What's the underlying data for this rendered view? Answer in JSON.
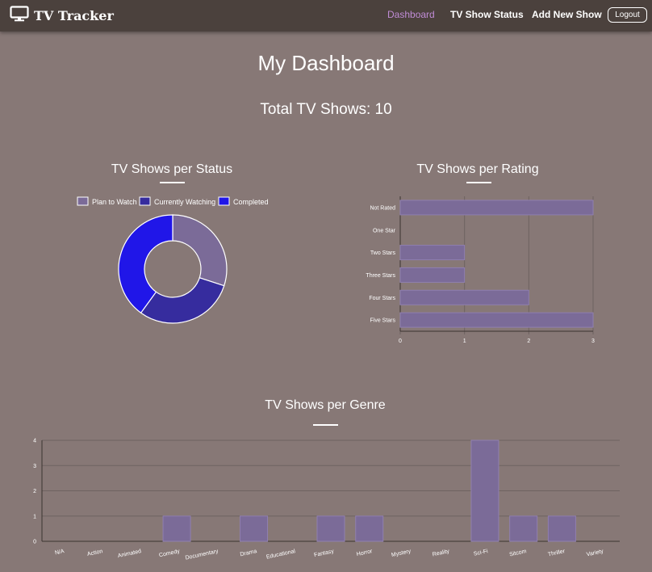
{
  "navbar": {
    "brand": "TV Tracker",
    "brand_icon": "tv-monitor-icon",
    "links": [
      {
        "label": "Dashboard",
        "active": true
      },
      {
        "label": "TV Show Status",
        "active": false
      },
      {
        "label": "Add New Show",
        "active": false
      }
    ],
    "logout_label": "Logout",
    "active_color": "#c08cd6",
    "bg_color": "#4b413d"
  },
  "page": {
    "title": "My Dashboard",
    "total_label": "Total TV Shows: 10",
    "bg_color": "#877876"
  },
  "status_chart": {
    "title": "TV Shows per Status"
  },
  "rating_chart": {
    "title": "TV Shows per Rating"
  },
  "genre_chart": {
    "title": "TV Shows per Genre"
  },
  "chart_data": [
    {
      "type": "pie",
      "title": "TV Shows per Status",
      "variant": "doughnut",
      "legend": "top",
      "categories": [
        "Plan to Watch",
        "Currently Watching",
        "Completed"
      ],
      "values": [
        3,
        3,
        4
      ],
      "colors": [
        "#7b6b98",
        "#362c9e",
        "#2016e8"
      ]
    },
    {
      "type": "bar",
      "title": "TV Shows per Rating",
      "orientation": "horizontal",
      "categories": [
        "Not Rated",
        "One Star",
        "Two Stars",
        "Three Stars",
        "Four Stars",
        "Five Stars"
      ],
      "values": [
        3,
        0,
        1,
        1,
        2,
        3
      ],
      "xlim": [
        0,
        3
      ],
      "xticks": [
        "0",
        "1",
        "2",
        "3"
      ],
      "grid": true,
      "bar_color": "#7b6b98"
    },
    {
      "type": "bar",
      "title": "TV Shows per Genre",
      "categories": [
        "N/A",
        "Action",
        "Animated",
        "Comedy",
        "Documentary",
        "Drama",
        "Educational",
        "Fantasy",
        "Horror",
        "Mystery",
        "Reality",
        "Sci-Fi",
        "Sitcom",
        "Thriller",
        "Variety"
      ],
      "values": [
        0,
        0,
        0,
        1,
        0,
        1,
        0,
        1,
        1,
        0,
        0,
        4,
        1,
        1,
        0
      ],
      "ylim": [
        0,
        4
      ],
      "yticks": [
        "0",
        "1",
        "2",
        "3",
        "4"
      ],
      "grid": true,
      "bar_color": "#7b6b98"
    }
  ]
}
